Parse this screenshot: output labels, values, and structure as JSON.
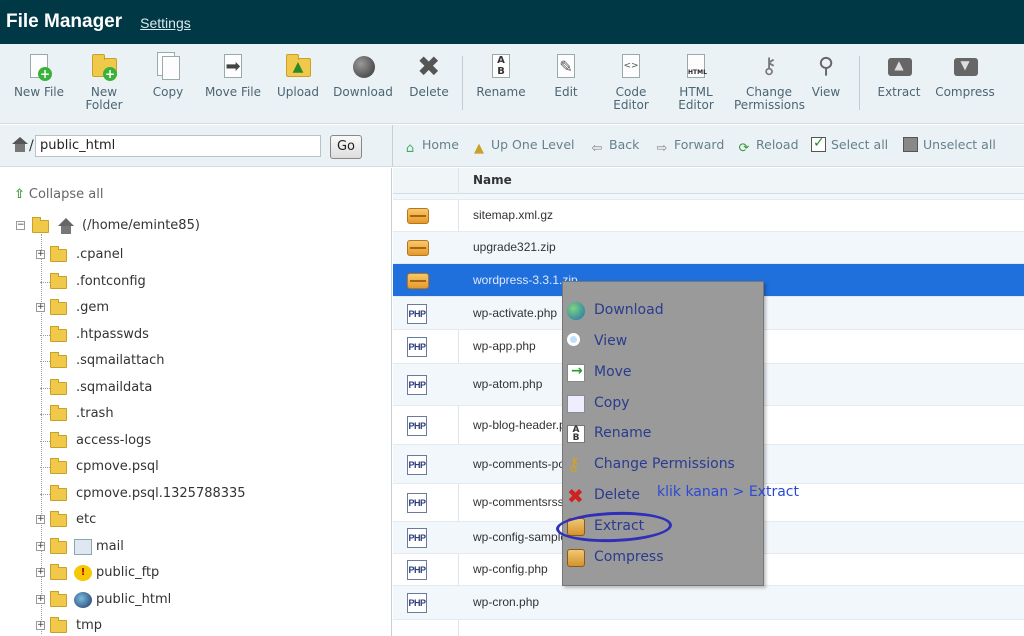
{
  "header": {
    "title": "File Manager",
    "settings_link": "Settings"
  },
  "toolbar": {
    "new_file": "New File",
    "new_folder": "New\nFolder",
    "copy": "Copy",
    "move_file": "Move File",
    "upload": "Upload",
    "download": "Download",
    "delete": "Delete",
    "rename": "Rename",
    "edit": "Edit",
    "code_editor": "Code\nEditor",
    "html_editor": "HTML\nEditor",
    "change_permissions": "Change\nPermissions",
    "view": "View",
    "extract": "Extract",
    "compress": "Compress"
  },
  "pathbar": {
    "path_slash": "/",
    "path_value": "public_html",
    "go": "Go"
  },
  "navbar": {
    "home": "Home",
    "up_one_level": "Up One Level",
    "back": "Back",
    "forward": "Forward",
    "reload": "Reload",
    "select_all": "Select all",
    "unselect_all": "Unselect all"
  },
  "tree": {
    "collapse_all": "Collapse all",
    "root": "(/home/eminte85)",
    "items": [
      {
        "name": ".cpanel",
        "expandable": true
      },
      {
        "name": ".fontconfig",
        "expandable": false
      },
      {
        "name": ".gem",
        "expandable": true
      },
      {
        "name": ".htpasswds",
        "expandable": false
      },
      {
        "name": ".sqmailattach",
        "expandable": false
      },
      {
        "name": ".sqmaildata",
        "expandable": false
      },
      {
        "name": ".trash",
        "expandable": false
      },
      {
        "name": "access-logs",
        "expandable": false
      },
      {
        "name": "cpmove.psql",
        "expandable": false
      },
      {
        "name": "cpmove.psql.1325788335",
        "expandable": false
      },
      {
        "name": "etc",
        "expandable": true
      },
      {
        "name": "mail",
        "expandable": true,
        "badge": "mail"
      },
      {
        "name": "public_ftp",
        "expandable": true,
        "badge": "ftp"
      },
      {
        "name": "public_html",
        "expandable": true,
        "badge": "web"
      },
      {
        "name": "tmp",
        "expandable": true
      }
    ]
  },
  "filelist": {
    "column_name": "Name",
    "files": [
      {
        "name": "sitemap.xml.gz",
        "type": "zip"
      },
      {
        "name": "upgrade321.zip",
        "type": "zip"
      },
      {
        "name": "wordpress-3.3.1.zip",
        "type": "zip",
        "selected": true
      },
      {
        "name": "wp-activate.php",
        "type": "php"
      },
      {
        "name": "wp-app.php",
        "type": "php"
      },
      {
        "name": "wp-atom.php",
        "type": "php"
      },
      {
        "name": "wp-blog-header.php",
        "type": "php"
      },
      {
        "name": "wp-comments-post.php",
        "type": "php"
      },
      {
        "name": "wp-commentsrss2.php",
        "type": "php"
      },
      {
        "name": "wp-config-sample.php",
        "type": "php"
      },
      {
        "name": "wp-config.php",
        "type": "php"
      },
      {
        "name": "wp-cron.php",
        "type": "php"
      }
    ]
  },
  "context_menu": {
    "download": "Download",
    "view": "View",
    "move": "Move",
    "copy": "Copy",
    "rename": "Rename",
    "change_permissions": "Change Permissions",
    "delete": "Delete",
    "extract": "Extract",
    "compress": "Compress"
  },
  "annotation": "klik kanan > Extract",
  "colors": {
    "header_bg": "#003845",
    "selection": "#1f6fdc",
    "annotation": "#2b49d8"
  }
}
